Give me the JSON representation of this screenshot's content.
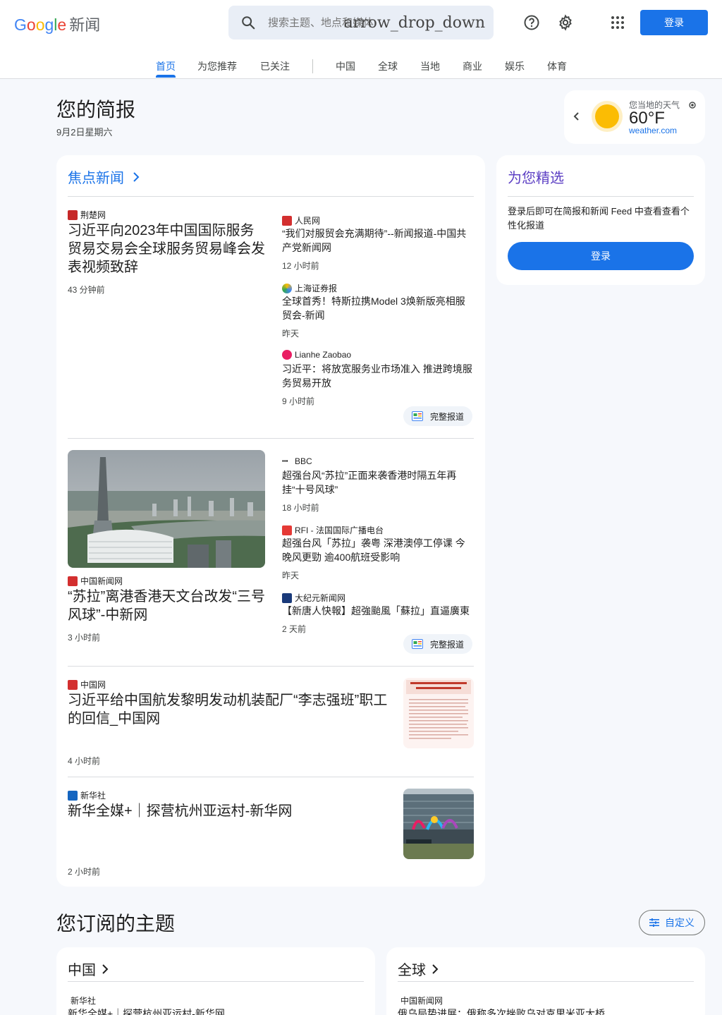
{
  "header": {
    "logo_google": [
      "G",
      "o",
      "o",
      "g",
      "l",
      "e"
    ],
    "logo_news": "新闻",
    "search_placeholder": "搜索主题、地点和媒体",
    "search_dropdown": "arrow_drop_down",
    "login_label": "登录",
    "icons": [
      "search-icon",
      "help-icon",
      "settings-icon",
      "apps-icon"
    ]
  },
  "tabs": [
    "首页",
    "为您推荐",
    "已关注",
    "中国",
    "全球",
    "当地",
    "商业",
    "娱乐",
    "体育"
  ],
  "briefing": {
    "title": "您的简报",
    "date": "9月2日星期六"
  },
  "weather": {
    "label": "您当地的天气",
    "temp": "60°F",
    "source": "weather.com"
  },
  "top_stories": {
    "title": "焦点新闻",
    "full_coverage": "完整报道",
    "cluster1": {
      "main": {
        "source": "荆楚网",
        "headline": "习近平向2023年中国国际服务贸易交易会全球服务贸易峰会发表视频致辞",
        "time": "43 分钟前"
      },
      "side": [
        {
          "source": "人民网",
          "headline": "“我们对服贸会充满期待”--新闻报道-中国共产党新闻网",
          "time": "12 小时前"
        },
        {
          "source": "上海证券报",
          "headline": "全球首秀！特斯拉携Model 3焕新版亮相服贸会-新闻",
          "time": "昨天"
        },
        {
          "source": "Lianhe Zaobao",
          "headline": "习近平：将放宽服务业市场准入 推进跨境服务贸易开放",
          "time": "9 小时前"
        }
      ]
    },
    "cluster2": {
      "main": {
        "source": "中国新闻网",
        "headline": "“苏拉”离港香港天文台改发“三号风球”-中新网",
        "time": "3 小时前"
      },
      "side": [
        {
          "source": "BBC",
          "headline": "超强台风“苏拉”正面来袭香港时隔五年再挂“十号风球”",
          "time": "18 小时前"
        },
        {
          "source": "RFI - 法国国际广播电台",
          "headline": "超强台风「苏拉」袭粤 深港澳停工停课 今晚风更勁 逾400航班受影响",
          "time": "昨天"
        },
        {
          "source": "大纪元新闻网",
          "headline": "【新唐人快報】超強颱風「蘇拉」直逼廣東",
          "time": "2 天前"
        }
      ]
    },
    "story3": {
      "source": "中国网",
      "headline": "习近平给中国航发黎明发动机装配厂“李志强班”职工的回信_中国网",
      "time": "4 小时前"
    },
    "story4": {
      "source": "新华社",
      "headline": "新华全媒+｜探营杭州亚运村-新华网",
      "time": "2 小时前"
    }
  },
  "for_you": {
    "title": "为您精选",
    "text": "登录后即可在简报和新闻 Feed 中查看查看个性化报道",
    "button": "登录"
  },
  "topics": {
    "title": "您订阅的主题",
    "customize": "自定义",
    "cards": [
      {
        "title": "中国",
        "source": "新华社",
        "headline": "新华全媒+｜探营杭州亚运村-新华网"
      },
      {
        "title": "全球",
        "source": "中国新闻网",
        "headline": "俄乌局势进展：俄称多次挫败乌对克里米亚大桥"
      }
    ]
  },
  "colors": {
    "accent": "#1a73e8",
    "for_you": "#5c3fc4",
    "background": "#f6f8fc"
  }
}
